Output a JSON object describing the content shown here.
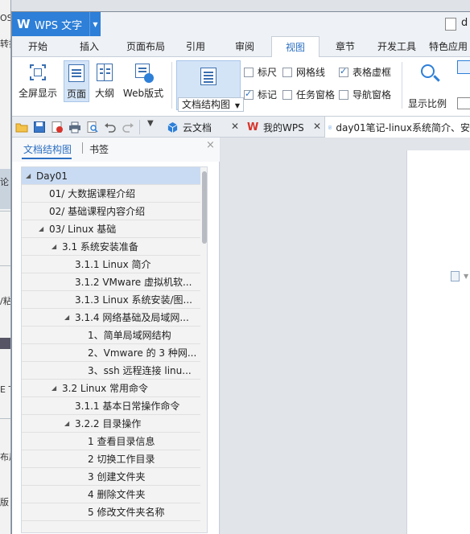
{
  "background": {
    "fragments": [
      "OS",
      "转换",
      "论",
      "/粘",
      "E T",
      "布局",
      "版"
    ]
  },
  "app": {
    "logo": "W",
    "name": "WPS 文字",
    "user_name": "d"
  },
  "menu": {
    "tabs": [
      "开始",
      "插入",
      "页面布局",
      "引用",
      "审阅",
      "视图",
      "章节",
      "开发工具",
      "特色应用"
    ],
    "active": "视图"
  },
  "ribbon": {
    "fullscreen_label": "全屏显示",
    "page_label": "页面",
    "outline_label": "大纲",
    "web_label": "Web版式",
    "doc_structure_label": "文档结构图",
    "checkboxes": {
      "ruler": {
        "label": "标尺",
        "checked": false
      },
      "gridlines": {
        "label": "网格线",
        "checked": false
      },
      "table_gridlines": {
        "label": "表格虚框",
        "checked": true
      },
      "markup": {
        "label": "标记",
        "checked": true
      },
      "task_pane": {
        "label": "任务窗格",
        "checked": false
      },
      "nav_pane": {
        "label": "导航窗格",
        "checked": false
      }
    },
    "zoom_label": "显示比例"
  },
  "tabs": {
    "cloud": "云文档",
    "mywps": "我的WPS",
    "doc": "day01笔记-linux系统简介、安"
  },
  "nav": {
    "tab_structure": "文档结构图",
    "tab_bookmarks": "书签",
    "close": "×",
    "tree": [
      {
        "text": "Day01",
        "level": 0,
        "arrow": "◢",
        "selected": true
      },
      {
        "text": "01/ 大数据课程介绍",
        "level": 1,
        "arrow": ""
      },
      {
        "text": "02/ 基础课程内容介绍",
        "level": 1,
        "arrow": ""
      },
      {
        "text": "03/ Linux 基础",
        "level": 1,
        "arrow": "◢"
      },
      {
        "text": "3.1  系统安装准备",
        "level": 2,
        "arrow": "◢"
      },
      {
        "text": "3.1.1 Linux 简介",
        "level": 3,
        "arrow": ""
      },
      {
        "text": "3.1.2 VMware 虚拟机软...",
        "level": 3,
        "arrow": ""
      },
      {
        "text": "3.1.3 Linux 系统安装/图...",
        "level": 3,
        "arrow": ""
      },
      {
        "text": "3.1.4  网络基础及局域网...",
        "level": 3,
        "arrow": "◢"
      },
      {
        "text": "1、简单局域网结构",
        "level": 4,
        "arrow": ""
      },
      {
        "text": "2、Vmware 的 3 种网...",
        "level": 4,
        "arrow": ""
      },
      {
        "text": "3、ssh 远程连接 linu...",
        "level": 4,
        "arrow": ""
      },
      {
        "text": "3.2 Linux 常用命令",
        "level": 2,
        "arrow": "◢"
      },
      {
        "text": "3.1.1  基本日常操作命令",
        "level": 3,
        "arrow": ""
      },
      {
        "text": "3.2.2  目录操作",
        "level": 3,
        "arrow": "◢"
      },
      {
        "text": "1 查看目录信息",
        "level": 4,
        "arrow": ""
      },
      {
        "text": "2 切换工作目录",
        "level": 4,
        "arrow": ""
      },
      {
        "text": "3 创建文件夹",
        "level": 4,
        "arrow": ""
      },
      {
        "text": "4 删除文件夹",
        "level": 4,
        "arrow": ""
      },
      {
        "text": "5 修改文件夹名称",
        "level": 4,
        "arrow": ""
      }
    ]
  },
  "colors": {
    "accent": "#2d7fd8",
    "selected_node": "#c9dbf2"
  }
}
